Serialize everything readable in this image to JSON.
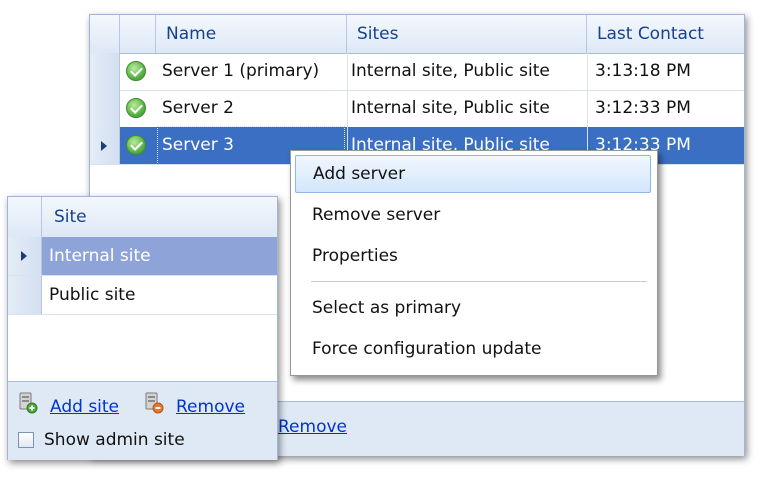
{
  "servers": {
    "columns": [
      "Name",
      "Sites",
      "Last Contact"
    ],
    "rows": [
      {
        "name": "Server 1 (primary)",
        "sites": "Internal site, Public site",
        "last_contact": "3:13:18 PM"
      },
      {
        "name": "Server 2",
        "sites": "Internal site, Public site",
        "last_contact": "3:12:33 PM"
      },
      {
        "name": "Server 3",
        "sites": "Internal site, Public site",
        "last_contact": "3:12:33 PM"
      }
    ],
    "footer_remove_label": "Remove"
  },
  "context_menu": {
    "items": [
      "Add server",
      "Remove server",
      "Properties",
      "Select as primary",
      "Force configuration update"
    ]
  },
  "sites": {
    "column": "Site",
    "rows": [
      "Internal site",
      "Public site"
    ],
    "add_label": "Add site",
    "remove_label": "Remove",
    "show_admin_label": "Show admin site"
  },
  "colors": {
    "selection": "#3b6fc3",
    "header_text": "#15428b",
    "link": "#0033cc",
    "status_ok": "#4aa93a"
  },
  "icons": {
    "status": "check-circle-icon",
    "add_site": "server-add-icon",
    "remove_site": "server-remove-icon",
    "row_indicator": "row-arrow-icon"
  }
}
